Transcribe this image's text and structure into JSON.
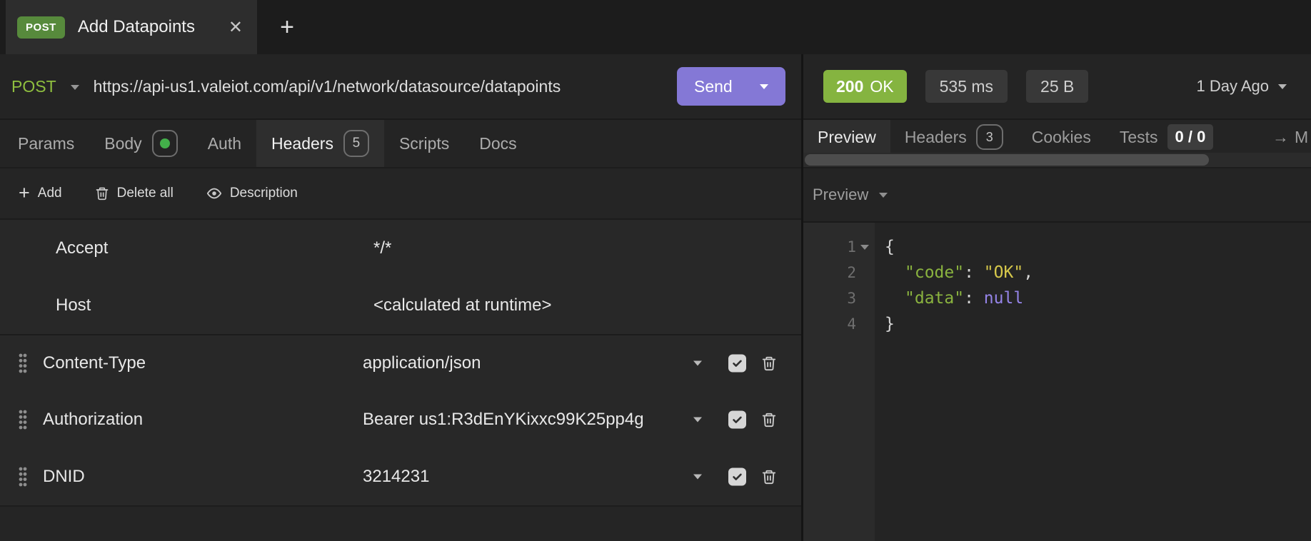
{
  "tab_bar": {
    "active_tab": {
      "method": "POST",
      "title": "Add Datapoints",
      "close_icon": "✕"
    },
    "new_tab_icon": "+"
  },
  "url_bar": {
    "method": "POST",
    "url": "https://api-us1.valeiot.com/api/v1/network/datasource/datapoints",
    "send_label": "Send"
  },
  "response_meta": {
    "status_code": "200",
    "status_text": "OK",
    "duration": "535 ms",
    "size": "25 B",
    "history_label": "1 Day Ago"
  },
  "request_tabs": {
    "params": "Params",
    "body": "Body",
    "auth": "Auth",
    "headers": "Headers",
    "headers_count": "5",
    "scripts": "Scripts",
    "docs": "Docs"
  },
  "response_tabs": {
    "preview": "Preview",
    "headers": "Headers",
    "headers_count": "3",
    "cookies": "Cookies",
    "tests": "Tests",
    "tests_badge": "0 / 0",
    "more_arrow": "→",
    "more_label": "M"
  },
  "headers_toolbar": {
    "add_icon": "+",
    "add": "Add",
    "delete_all": "Delete all",
    "description": "Description"
  },
  "headers_table": {
    "readonly_rows": [
      {
        "name": "Accept",
        "value": "*/*"
      },
      {
        "name": "Host",
        "value": "<calculated at runtime>"
      }
    ],
    "rows": [
      {
        "name": "Content-Type",
        "value": "application/json"
      },
      {
        "name": "Authorization",
        "value": "Bearer us1:R3dEnYKixxc99K25pp4g"
      },
      {
        "name": "DNID",
        "value": "3214231"
      }
    ]
  },
  "preview_pane": {
    "mode_label": "Preview"
  },
  "response_body": {
    "language": "json",
    "text": "{\n  \"code\": \"OK\",\n  \"data\": null\n}",
    "lines": [
      {
        "num": "1",
        "open_brace": "{"
      },
      {
        "num": "2",
        "key": "\"code\"",
        "sep": ": ",
        "value": "\"OK\"",
        "comma": ","
      },
      {
        "num": "3",
        "key": "\"data\"",
        "sep": ": ",
        "value": "null"
      },
      {
        "num": "4",
        "close_brace": "}"
      }
    ]
  },
  "colors": {
    "method_green": "#8fbf3f",
    "tab_badge_green": "#578a3c",
    "status_green": "#85b440",
    "send_purple": "#8478d6",
    "body_dot_green": "#43b04a",
    "json_key": "#8ab33f",
    "json_string": "#d6c84b",
    "json_null": "#9584e8"
  }
}
